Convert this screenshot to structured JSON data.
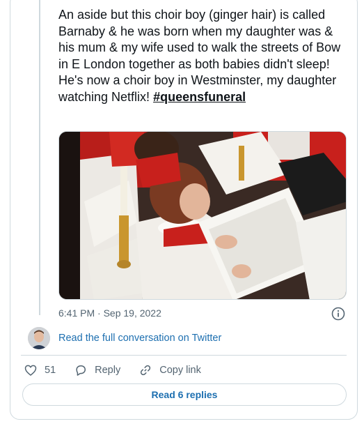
{
  "tweet": {
    "text_before": "An aside but this choir boy (ginger hair) is called Barnaby & he was born when my daughter was & his mum & my wife used to walk the streets of Bow in E London together as both babies didn't sleep! He's now a choir boy in Westminster, my daughter watching Netflix! ",
    "hashtag": "#queensfuneral",
    "timestamp": "6:41 PM · Sep 19, 2022"
  },
  "conversation": {
    "read_full_label": "Read the full conversation on Twitter"
  },
  "actions": {
    "like_count": "51",
    "reply_label": "Reply",
    "copy_link_label": "Copy link"
  },
  "footer": {
    "read_replies_label": "Read 6 replies"
  },
  "colors": {
    "link_blue": "#1d6fb0",
    "border": "#cfd9de",
    "muted_text": "#536471",
    "robe_red": "#c8201c"
  }
}
